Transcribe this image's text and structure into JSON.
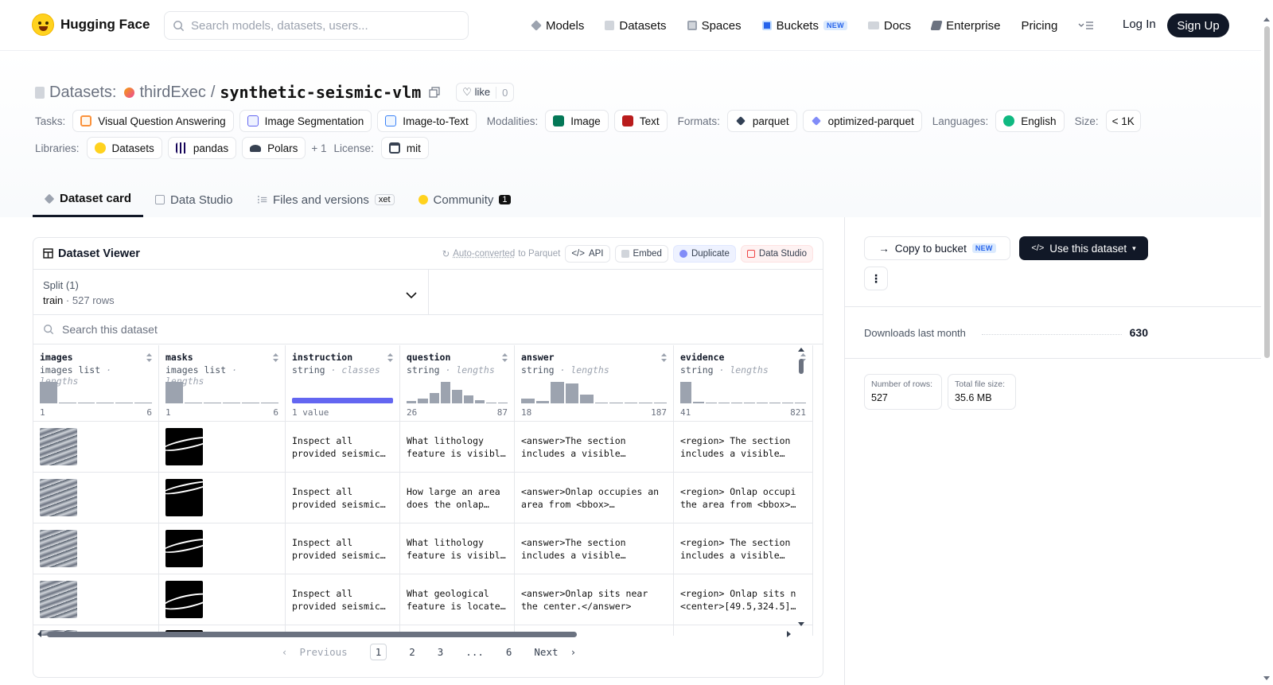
{
  "nav": {
    "logo_text": "Hugging Face",
    "search_placeholder": "Search models, datasets, users...",
    "links": [
      "Models",
      "Datasets",
      "Spaces",
      "Buckets",
      "Docs",
      "Enterprise",
      "Pricing"
    ],
    "new_badge": "NEW",
    "login": "Log In",
    "signup": "Sign Up"
  },
  "header": {
    "label": "Datasets:",
    "user": "thirdExec",
    "sep": "/",
    "repo": "synthetic-seismic-vlm",
    "like_label": "like",
    "like_count": "0"
  },
  "tags": {
    "tasks_label": "Tasks:",
    "tasks": [
      "Visual Question Answering",
      "Image Segmentation",
      "Image-to-Text"
    ],
    "modalities_label": "Modalities:",
    "modalities": [
      "Image",
      "Text"
    ],
    "formats_label": "Formats:",
    "formats": [
      "parquet",
      "optimized-parquet"
    ],
    "languages_label": "Languages:",
    "languages": [
      "English"
    ],
    "size_label": "Size:",
    "size": "< 1K",
    "libraries_label": "Libraries:",
    "libraries": [
      "Datasets",
      "pandas",
      "Polars"
    ],
    "libraries_more": "+ 1",
    "license_label": "License:",
    "license": "mit"
  },
  "tabs": {
    "card": "Dataset card",
    "studio": "Data Studio",
    "files": "Files and versions",
    "xet": "xet",
    "community": "Community",
    "community_count": "1"
  },
  "viewer": {
    "title": "Dataset Viewer",
    "auto_converted": "Auto-converted",
    "to_parquet": "to Parquet",
    "api": "API",
    "embed": "Embed",
    "duplicate": "Duplicate",
    "data_studio": "Data Studio",
    "split_label": "Split (1)",
    "split_name": "train",
    "split_rows": "527 rows",
    "search_placeholder": "Search this dataset",
    "columns": [
      {
        "name": "images",
        "type": "images list",
        "stat": "lengths",
        "min": "1",
        "max": "6",
        "hist": [
          0.95,
          0.05,
          0.03,
          0.03,
          0.03,
          0.03
        ]
      },
      {
        "name": "masks",
        "type": "images list",
        "stat": "lengths",
        "min": "1",
        "max": "6",
        "hist": [
          0.95,
          0.05,
          0.03,
          0.03,
          0.03,
          0.03
        ]
      },
      {
        "name": "instruction",
        "type": "string",
        "stat": "classes",
        "min": "1 value",
        "max": "",
        "hist": []
      },
      {
        "name": "question",
        "type": "string",
        "stat": "lengths",
        "min": "26",
        "max": "87",
        "hist": [
          0.1,
          0.2,
          0.45,
          0.95,
          0.6,
          0.35,
          0.15,
          0.05,
          0.03
        ]
      },
      {
        "name": "answer",
        "type": "string",
        "stat": "lengths",
        "min": "18",
        "max": "187",
        "hist": [
          0.2,
          0.1,
          0.95,
          0.9,
          0.4,
          0.05,
          0.05,
          0.03,
          0.03,
          0.03
        ]
      },
      {
        "name": "evidence",
        "type": "string",
        "stat": "lengths",
        "min": "41",
        "max": "821",
        "hist": [
          0.95,
          0.08,
          0.04,
          0.04,
          0.04,
          0,
          0,
          0,
          0.04,
          0.04
        ]
      }
    ],
    "rows": [
      {
        "instruction": "Inspect all\nprovided seismic…",
        "question": "What lithology\nfeature is visibl…",
        "answer": "<answer>The section\nincludes a visible…",
        "evidence": "<region> The section\nincludes a visible…"
      },
      {
        "instruction": "Inspect all\nprovided seismic…",
        "question": "How large an area\ndoes the onlap…",
        "answer": "<answer>Onlap occupies an\narea from <bbox>…",
        "evidence": "<region> Onlap occupi\nthe area from <bbox>…"
      },
      {
        "instruction": "Inspect all\nprovided seismic…",
        "question": "What lithology\nfeature is visibl…",
        "answer": "<answer>The section\nincludes a visible…",
        "evidence": "<region> The section\nincludes a visible…"
      },
      {
        "instruction": "Inspect all\nprovided seismic…",
        "question": "What geological\nfeature is locate…",
        "answer": "<answer>Onlap sits near\nthe center.</answer>",
        "evidence": "<region> Onlap sits n\n<center>[49.5,324.5]…"
      }
    ],
    "pager": {
      "prev": "Previous",
      "pages": [
        "1",
        "2",
        "3",
        "...",
        "6"
      ],
      "next": "Next"
    }
  },
  "side": {
    "copy_to_bucket": "Copy to bucket",
    "new_badge": "NEW",
    "use_dataset": "Use this dataset",
    "downloads_label": "Downloads last month",
    "downloads_value": "630",
    "rows_label": "Number of rows:",
    "rows_value": "527",
    "size_label": "Total file size:",
    "size_value": "35.6 MB"
  }
}
